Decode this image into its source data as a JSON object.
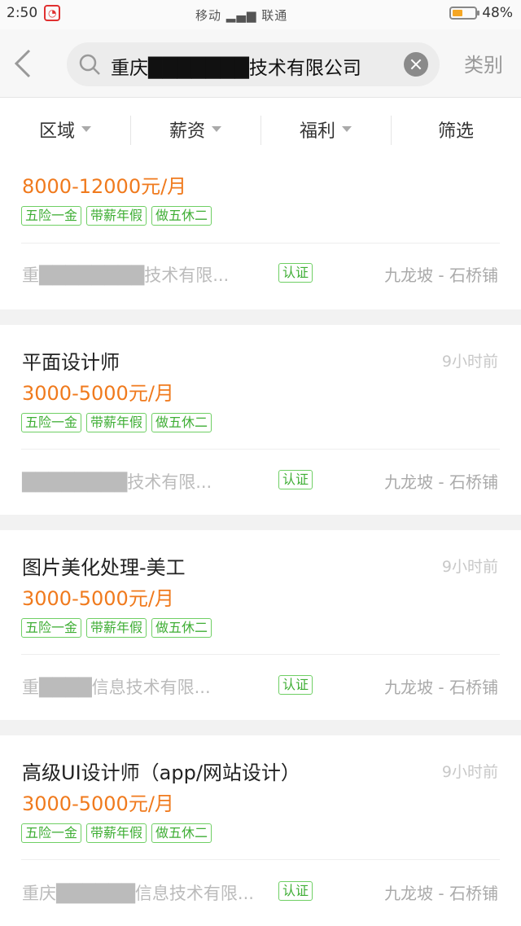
{
  "status_bar": {
    "time": "2:50",
    "carrier1": "移动",
    "carrier2": "联通",
    "battery": "48%",
    "battery_level": 0.48
  },
  "header": {
    "search_query": "重庆███████技术有限公司",
    "category_label": "类别"
  },
  "filters": [
    {
      "label": "区域"
    },
    {
      "label": "薪资"
    },
    {
      "label": "福利"
    },
    {
      "label": "筛选"
    }
  ],
  "jobs": [
    {
      "title": "",
      "time": "",
      "salary": "8000-12000元/月",
      "tags": [
        "五险一金",
        "带薪年假",
        "做五休二"
      ],
      "company": "重████████技术有限...",
      "verified": "认证",
      "location": "九龙坡 - 石桥铺"
    },
    {
      "title": "平面设计师",
      "time": "9小时前",
      "salary": "3000-5000元/月",
      "tags": [
        "五险一金",
        "带薪年假",
        "做五休二"
      ],
      "company": "████████技术有限...",
      "verified": "认证",
      "location": "九龙坡 - 石桥铺"
    },
    {
      "title": "图片美化处理-美工",
      "time": "9小时前",
      "salary": "3000-5000元/月",
      "tags": [
        "五险一金",
        "带薪年假",
        "做五休二"
      ],
      "company": "重████信息技术有限...",
      "verified": "认证",
      "location": "九龙坡 - 石桥铺"
    },
    {
      "title": "高级UI设计师（app/网站设计）",
      "time": "9小时前",
      "salary": "3000-5000元/月",
      "tags": [
        "五险一金",
        "带薪年假",
        "做五休二"
      ],
      "company": "重庆██████信息技术有限...",
      "verified": "认证",
      "location": "九龙坡 - 石桥铺"
    }
  ]
}
